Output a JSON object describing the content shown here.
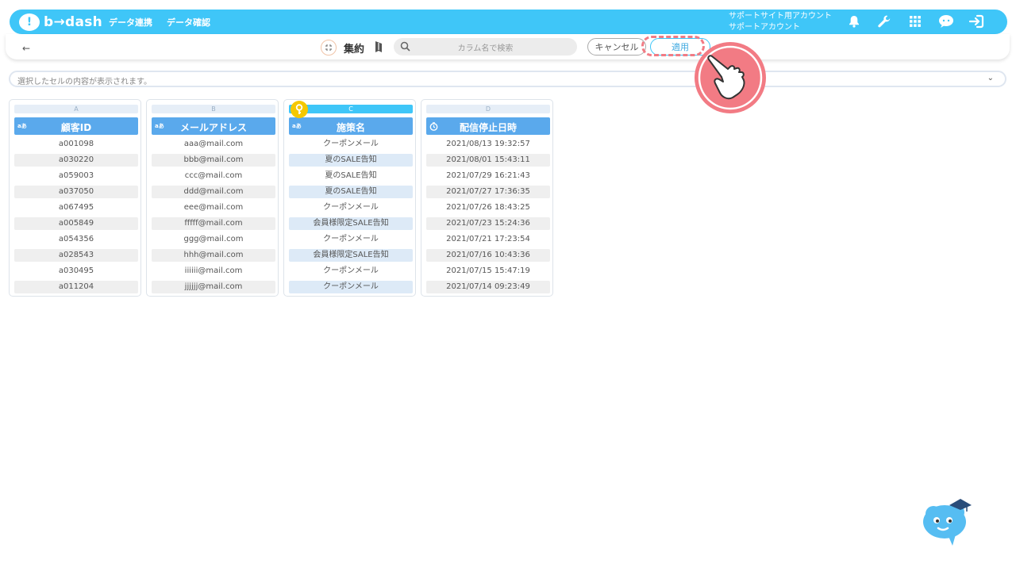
{
  "header": {
    "logo_mark": "!",
    "logo_text": "b→dash",
    "nav": [
      "データ連携",
      "データ確認"
    ],
    "account_line1": "サポートサイト用アカウント",
    "account_line2": "サポートアカウント",
    "icons": [
      "bell-icon",
      "wrench-icon",
      "grid-icon",
      "chat-icon",
      "logout-icon"
    ],
    "brand_color": "#3fc6f8"
  },
  "toolbar": {
    "back_icon": "←",
    "aggregate_label": "集約",
    "search_placeholder": "カラム名で検索",
    "cancel_label": "キャンセル",
    "apply_label": "適用"
  },
  "cell_preview": {
    "placeholder": "選択したセルの内容が表示されます。"
  },
  "columns": [
    {
      "letter": "A",
      "type_badge": "aあ",
      "title": "顧客ID",
      "selected": false,
      "rows": [
        "a001098",
        "a030220",
        "a059003",
        "a037050",
        "a067495",
        "a005849",
        "a054356",
        "a028543",
        "a030495",
        "a011204"
      ]
    },
    {
      "letter": "B",
      "type_badge": "aあ",
      "title": "メールアドレス",
      "selected": false,
      "rows": [
        "aaa@mail.com",
        "bbb@mail.com",
        "ccc@mail.com",
        "ddd@mail.com",
        "eee@mail.com",
        "fffff@mail.com",
        "ggg@mail.com",
        "hhh@mail.com",
        "iiiiii@mail.com",
        "jjjjjj@mail.com"
      ]
    },
    {
      "letter": "C",
      "type_badge": "aあ",
      "title": "施策名",
      "selected": true,
      "rows": [
        "クーポンメール",
        "夏のSALE告知",
        "夏のSALE告知",
        "夏のSALE告知",
        "クーポンメール",
        "会員様限定SALE告知",
        "クーポンメール",
        "会員様限定SALE告知",
        "クーポンメール",
        "クーポンメール"
      ]
    },
    {
      "letter": "D",
      "type_badge": "clock-icon",
      "title": "配信停止日時",
      "selected": false,
      "rows": [
        "2021/08/13 19:32:57",
        "2021/08/01 15:43:11",
        "2021/07/29 16:21:43",
        "2021/07/27 17:36:35",
        "2021/07/26 18:43:25",
        "2021/07/23 15:24:36",
        "2021/07/21 17:23:54",
        "2021/07/16 10:43:36",
        "2021/07/15 15:47:19",
        "2021/07/14 09:23:49"
      ]
    }
  ],
  "annotations": {
    "highlight_color": "#f27b84",
    "pointer_icon": "pointing-hand-icon",
    "key_icon": "key-icon",
    "mascot_icon": "mascot-icon"
  }
}
